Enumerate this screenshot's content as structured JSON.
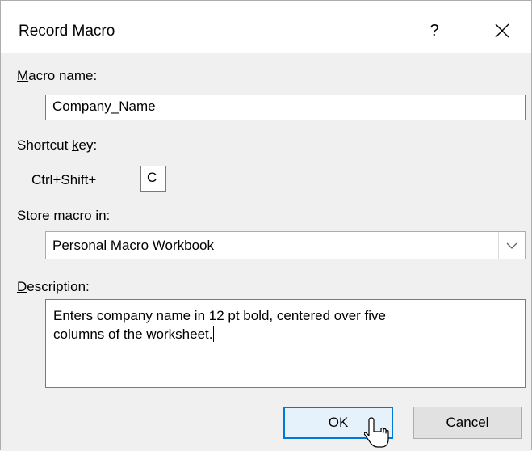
{
  "dialog": {
    "title": "Record Macro",
    "help_label": "?"
  },
  "macro_name": {
    "label_ul": "M",
    "label_rest": "acro name:",
    "value": "Company_Name"
  },
  "shortcut": {
    "label_pre": "Shortcut ",
    "label_ul": "k",
    "label_rest": "ey:",
    "prefix": "Ctrl+Shift+",
    "key": "C"
  },
  "store": {
    "label_pre": "Store macro ",
    "label_ul": "i",
    "label_rest": "n:",
    "selected": "Personal Macro Workbook"
  },
  "description": {
    "label_ul": "D",
    "label_rest": "escription:",
    "line1": "Enters company name in 12 pt bold, centered over five",
    "line2": "columns of the worksheet."
  },
  "buttons": {
    "ok": "OK",
    "cancel": "Cancel"
  },
  "colors": {
    "accent": "#0078d7",
    "dialog_bg": "#f0f0f0",
    "button_bg": "#e1e1e1"
  }
}
